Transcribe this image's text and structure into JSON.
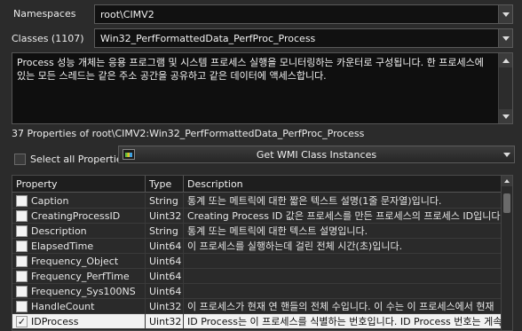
{
  "namespaces": {
    "label": "Namespaces",
    "value": "root\\CIMV2"
  },
  "classes": {
    "label": "Classes (1107)",
    "value": "Win32_PerfFormattedData_PerfProc_Process"
  },
  "class_description": "Process 성능 개체는 응용 프로그램 및 시스템 프로세스 실행을 모니터링하는 카운터로 구성됩니다. 한 프로세스에 있는 모든 스레드는 같은 주소 공간을 공유하고 같은 데이터에 액세스합니다.",
  "properties_header": "37 Properties of root\\CIMV2:Win32_PerfFormattedData_PerfProc_Process",
  "select_all_label": "Select all Properties",
  "get_instances_label": "Get WMI Class Instances",
  "grid": {
    "columns": {
      "property": "Property",
      "type": "Type",
      "description": "Description"
    },
    "rows": [
      {
        "name": "Caption",
        "type": "String",
        "desc": "통계 또는 메트릭에 대한 짧은 텍스트 설명(1줄 문자열)입니다.",
        "checked": false,
        "selected": false
      },
      {
        "name": "CreatingProcessID",
        "type": "Uint32",
        "desc": "Creating Process ID 값은 프로세스를 만든 프로세스의 프로세스 ID입니다.",
        "checked": false,
        "selected": false
      },
      {
        "name": "Description",
        "type": "String",
        "desc": "통계 또는 메트릭에 대한 텍스트 설명입니다.",
        "checked": false,
        "selected": false
      },
      {
        "name": "ElapsedTime",
        "type": "Uint64",
        "desc": "이 프로세스를 실행하는데 걸린 전체 시간(초)입니다.",
        "checked": false,
        "selected": false
      },
      {
        "name": "Frequency_Object",
        "type": "Uint64",
        "desc": "",
        "checked": false,
        "selected": false
      },
      {
        "name": "Frequency_PerfTime",
        "type": "Uint64",
        "desc": "",
        "checked": false,
        "selected": false
      },
      {
        "name": "Frequency_Sys100NS",
        "type": "Uint64",
        "desc": "",
        "checked": false,
        "selected": false
      },
      {
        "name": "HandleCount",
        "type": "Uint32",
        "desc": "이 프로세스가 현재 연 핸들의 전체 수입니다. 이 수는 이 프로세스에서 현재",
        "checked": false,
        "selected": false
      },
      {
        "name": "IDProcess",
        "type": "Uint32",
        "desc": "ID Process는 이 프로세스를 식별하는 번호입니다. ID Process 번호는 게속",
        "checked": true,
        "selected": true
      }
    ]
  }
}
